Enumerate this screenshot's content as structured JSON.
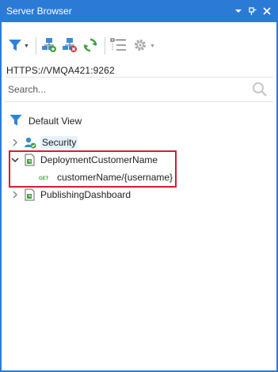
{
  "window": {
    "title": "Server Browser",
    "colors": {
      "accent": "#2b7bd6",
      "highlight": "#d11f2e"
    }
  },
  "titlebar_icons": [
    "dropdown-arrow-icon",
    "pin-icon",
    "close-icon"
  ],
  "toolbar": {
    "tools": [
      "filter-icon",
      "add-server-icon",
      "remove-server-icon",
      "refresh-icon",
      "list-view-icon",
      "settings-icon"
    ]
  },
  "server": {
    "url": "HTTPS://VMQA421:9262"
  },
  "search": {
    "placeholder": "Search..."
  },
  "filter": {
    "label": "Default View"
  },
  "tree": {
    "nodes": [
      {
        "label": "Security",
        "expanded": false
      },
      {
        "label": "DeploymentCustomerName",
        "expanded": true,
        "children": [
          {
            "badge": "GET",
            "label": "customerName/{username}"
          }
        ]
      },
      {
        "label": "PublishingDashboard",
        "expanded": false
      }
    ]
  }
}
